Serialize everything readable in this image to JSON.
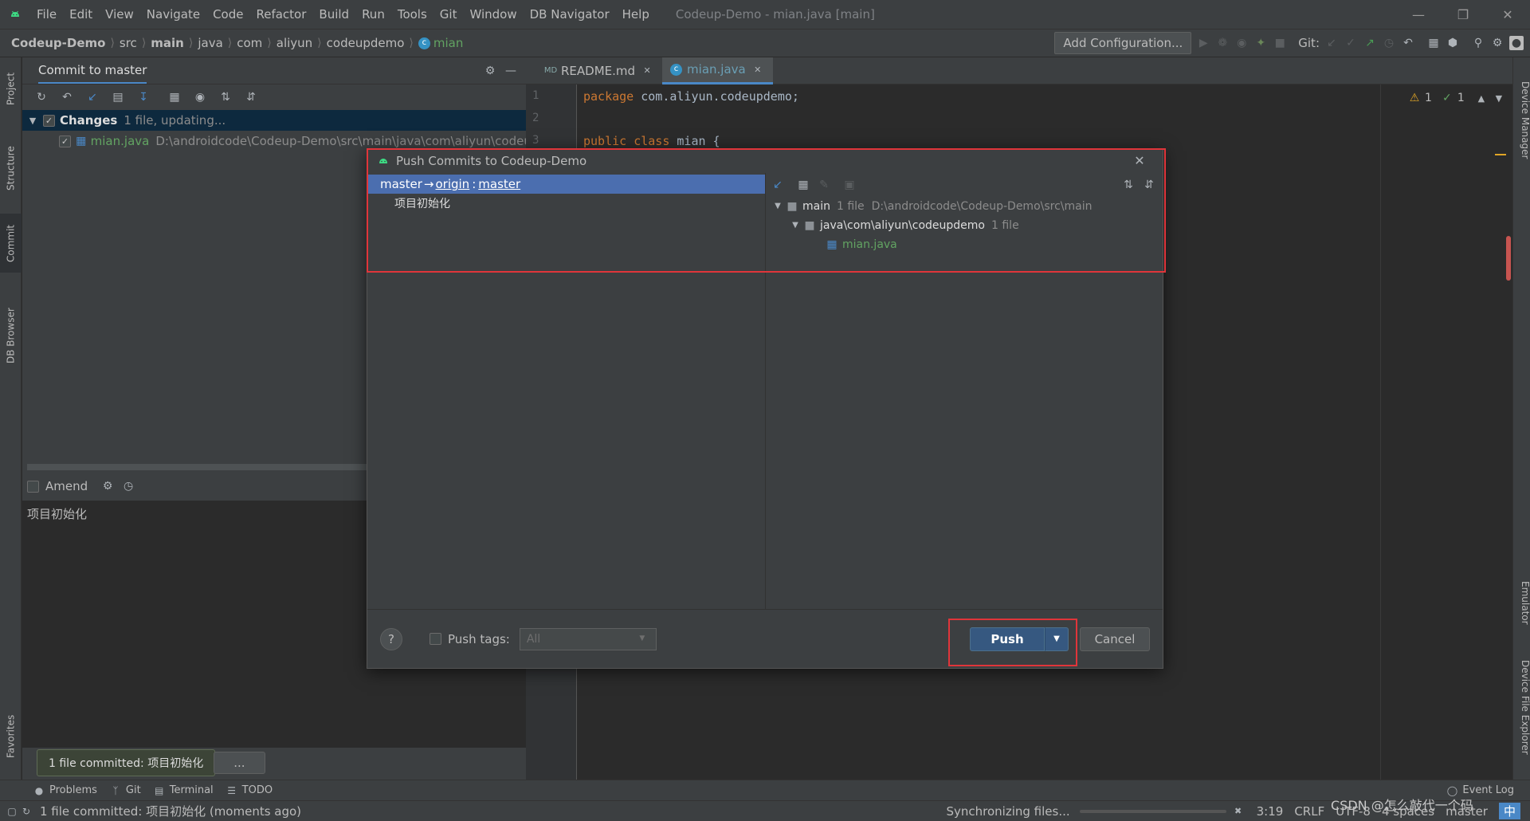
{
  "menubar": {
    "items": [
      "File",
      "Edit",
      "View",
      "Navigate",
      "Code",
      "Refactor",
      "Build",
      "Run",
      "Tools",
      "Git",
      "Window",
      "DB Navigator",
      "Help"
    ],
    "title": "Codeup-Demo - mian.java [main]"
  },
  "navbar": {
    "crumbs": [
      "Codeup-Demo",
      "src",
      "main",
      "java",
      "com",
      "aliyun",
      "codeupdemo",
      "mian"
    ],
    "add_configuration": "Add Configuration...",
    "git_label": "Git:"
  },
  "left_stripe": {
    "tabs": [
      "Project",
      "Structure",
      "Commit",
      "DB Browser",
      "Favorites"
    ]
  },
  "right_stripe": {
    "tabs": [
      "Device Manager",
      "Emulator",
      "Device File Explorer"
    ]
  },
  "commit_panel": {
    "header": "Commit to master",
    "changes_label": "Changes",
    "changes_meta": "1 file, updating...",
    "file_name": "mian.java",
    "file_path": "D:\\androidcode\\Codeup-Demo\\src\\main\\java\\com\\aliyun\\codeu",
    "amend_label": "Amend",
    "message": "项目初始化",
    "tooltip": "1 file committed: 项目初始化",
    "more": "..."
  },
  "editor": {
    "tabs": [
      {
        "label": "README.md",
        "icon": "markdown-icon"
      },
      {
        "label": "mian.java",
        "icon": "class-icon"
      }
    ],
    "line_numbers": [
      "1",
      "2",
      "3"
    ],
    "lines": [
      {
        "kw": "package",
        "rest": " com.aliyun.codeupdemo;"
      },
      {
        "kw": "",
        "rest": ""
      },
      {
        "kw": "public class",
        "rest": " mian {"
      }
    ],
    "warnings": "1",
    "ok_count": "1"
  },
  "dialog": {
    "title": "Push Commits to Codeup-Demo",
    "branch_local": "master",
    "branch_arrow": "→",
    "branch_remote": "origin",
    "branch_sep": ":",
    "branch_target": "master",
    "commit_message": "项目初始化",
    "tree": {
      "root_name": "main",
      "root_meta": "1 file  D:\\androidcode\\Codeup-Demo\\src\\main",
      "pkg_name": "java\\com\\aliyun\\codeupdemo",
      "pkg_meta": "1 file",
      "file_name": "mian.java"
    },
    "help": "?",
    "push_tags_label": "Push tags:",
    "push_tags_value": "All",
    "push_button": "Push",
    "cancel_button": "Cancel"
  },
  "bottom_tabs": [
    "Problems",
    "Git",
    "Terminal",
    "TODO"
  ],
  "event_log": "Event Log",
  "status": {
    "message": "1 file committed: 项目初始化 (moments ago)",
    "sync": "Synchronizing files...",
    "position": "3:19",
    "line_sep": "CRLF",
    "encoding": "UTF-8",
    "indent": "4 spaces",
    "branch": "master",
    "watermark": "CSDN @怎么敲代一个码",
    "ime": "中"
  },
  "colors": {
    "accent": "#4b6eaf",
    "highlight": "#e0353a",
    "keyword": "#cc7832",
    "file_green": "#62a362"
  }
}
